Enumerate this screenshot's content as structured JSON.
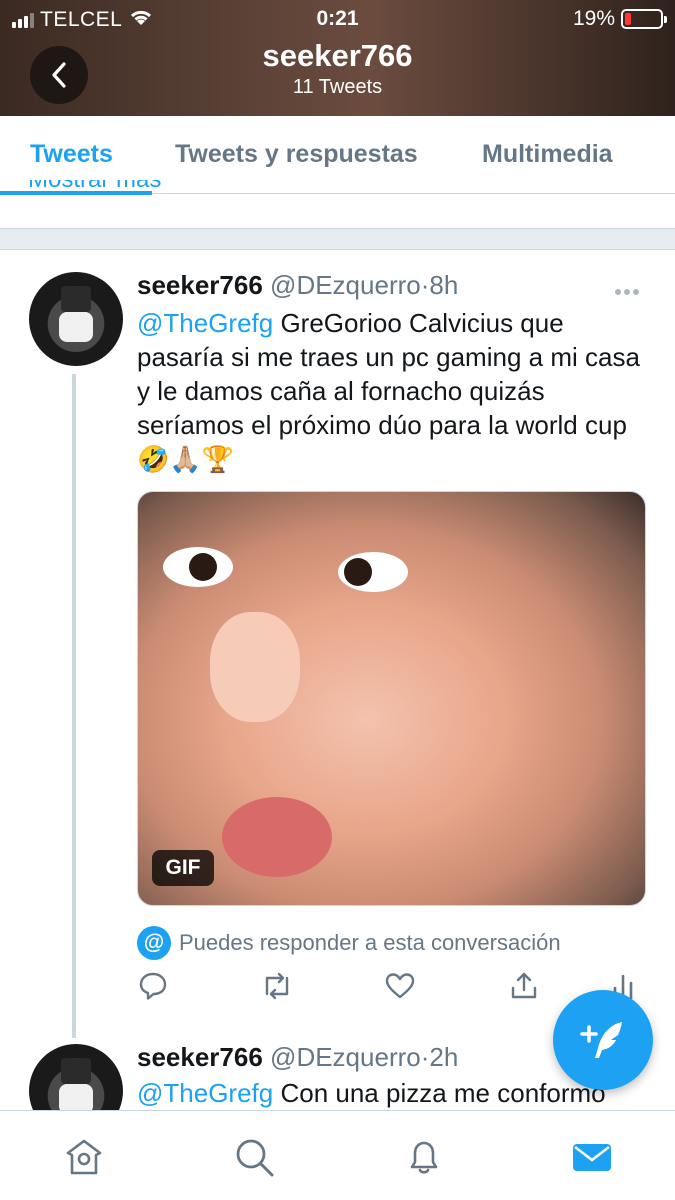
{
  "status_bar": {
    "carrier": "TELCEL",
    "time": "0:21",
    "battery": "19%",
    "battery_level": 0.19,
    "icons": [
      "signal-icon",
      "wifi-icon",
      "battery-icon"
    ]
  },
  "header": {
    "title": "seeker766",
    "subtitle": "11 Tweets",
    "back_icon": "chevron-left-icon"
  },
  "tabs": [
    {
      "label": "Tweets",
      "active": true
    },
    {
      "label": "Tweets y respuestas",
      "active": false
    },
    {
      "label": "Multimedia",
      "active": false
    }
  ],
  "clipped_text": "Mostrar más",
  "tweets": [
    {
      "name": "seeker766",
      "handle": "@DEzquerro",
      "separator": "·",
      "time": "8h",
      "mention": "@TheGrefg",
      "text": " GreGorioo Calvicius que pasaría si me traes un pc gaming a mi casa y le damos caña al fornacho quizás seríamos el próximo dúo para la world cup 🤣🙏🏼🏆",
      "media_badge": "GIF",
      "reply_note": "Puedes responder a esta conversación",
      "reply_note_icon": "at-icon",
      "actions": [
        "reply-icon",
        "retweet-icon",
        "like-icon",
        "share-icon",
        "analytics-icon"
      ],
      "more_icon": "more-icon"
    },
    {
      "name": "seeker766",
      "handle": "@DEzquerro",
      "separator": "·",
      "time": "2h",
      "mention": "@TheGrefg",
      "text": " Con una pizza me conformo"
    }
  ],
  "fab_icon": "compose-icon",
  "bottom_nav": [
    "home-icon",
    "search-icon",
    "notifications-icon",
    "messages-icon"
  ],
  "colors": {
    "accent": "#1da1f2",
    "secondary_text": "#657786",
    "border": "#ccd6dd",
    "battery_low": "#ff3b30"
  }
}
